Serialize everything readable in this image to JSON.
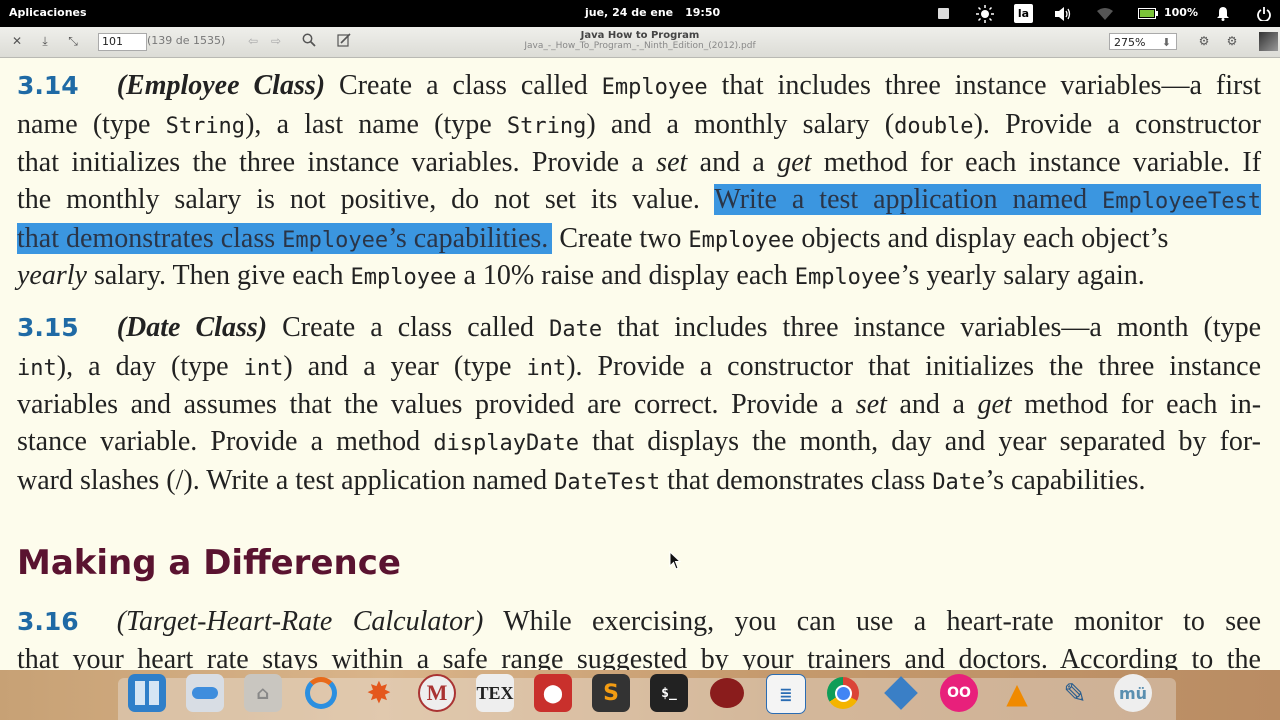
{
  "topbar": {
    "apps_label": "Aplicaciones",
    "date": "jue, 24 de ene",
    "time": "19:50",
    "keyboard_layout": "la",
    "battery_percent": "100%"
  },
  "toolbar": {
    "page_value": "101",
    "page_count": "(139 de 1535)",
    "title": "Java How to Program",
    "filename": "Java_-_How_To_Program_-_Ninth_Edition_(2012).pdf",
    "zoom": "275%"
  },
  "document": {
    "e314": {
      "num": "3.14",
      "title": "(Employee Class)",
      "l1a": "Create a class called",
      "l1code": "Employee",
      "l1b": "that includes three instance variables—a first",
      "l2a": "name (type",
      "l2code1": "String",
      "l2b": "), a last name (type",
      "l2code2": "String",
      "l2c": ") and a monthly salary (",
      "l2code3": "double",
      "l2d": "). Provide a constructor",
      "l3a": "that initializes the three instance variables. Provide a",
      "l3set": "set",
      "l3b": "and a",
      "l3get": "get",
      "l3c": "method for each instance variable. If",
      "l4a": "the monthly salary is not positive, do not set its value.",
      "l4hl": "Write a test application named",
      "l4code": "EmployeeTest",
      "l5hl1": "that demonstrates class",
      "l5code": "Employee",
      "l5hl2": "’s capabilities.",
      "l5b": "Create two",
      "l5code2": "Employee",
      "l5c": "objects and display each object’s",
      "l6it": "yearly",
      "l6a": "salary. Then give each",
      "l6code": "Employee",
      "l6b": "a 10% raise and display each",
      "l6code2": "Employee",
      "l6c": "’s yearly salary again."
    },
    "e315": {
      "num": "3.15",
      "title": "(Date Class)",
      "l1a": "Create a class called",
      "l1code": "Date",
      "l1b": "that includes three instance variables—a month (type",
      "l2code1": "int",
      "l2a": "), a day (type",
      "l2code2": "int",
      "l2b": ") and a year (type",
      "l2code3": "int",
      "l2c": "). Provide a constructor that initializes the three instance",
      "l3a": "variables and assumes that the values provided are correct. Provide a",
      "l3set": "set",
      "l3b": "and a",
      "l3get": "get",
      "l3c": "method for each in-",
      "l4a": "stance variable. Provide a method",
      "l4code": "displayDate",
      "l4b": "that displays the month, day and year separated by for-",
      "l5a": "ward slashes (/). Write a test application named",
      "l5code": "DateTest",
      "l5b": "that demonstrates class",
      "l5code2": "Date",
      "l5c": "’s capabilities."
    },
    "heading": "Making a Difference",
    "e316": {
      "num": "3.16",
      "title": "(Target-Heart-Rate Calculator)",
      "l1": "While exercising, you can use a heart-rate monitor to see",
      "l2": "that your heart rate stays within a safe range suggested by your trainers and doctors. According to the"
    }
  },
  "dock": {
    "tex_label": "TEX",
    "items": [
      "workspaces-icon",
      "toggle-icon",
      "home-folder-icon",
      "refresh-icon",
      "burst-icon",
      "mendeley-icon",
      "tex-icon",
      "office-icon",
      "sublime-icon",
      "terminal-icon",
      "chameleon-icon",
      "document-viewer-icon",
      "chrome-icon",
      "box-icon",
      "flickr-icon",
      "vlc-icon",
      "pen-icon",
      "mu-icon"
    ]
  }
}
